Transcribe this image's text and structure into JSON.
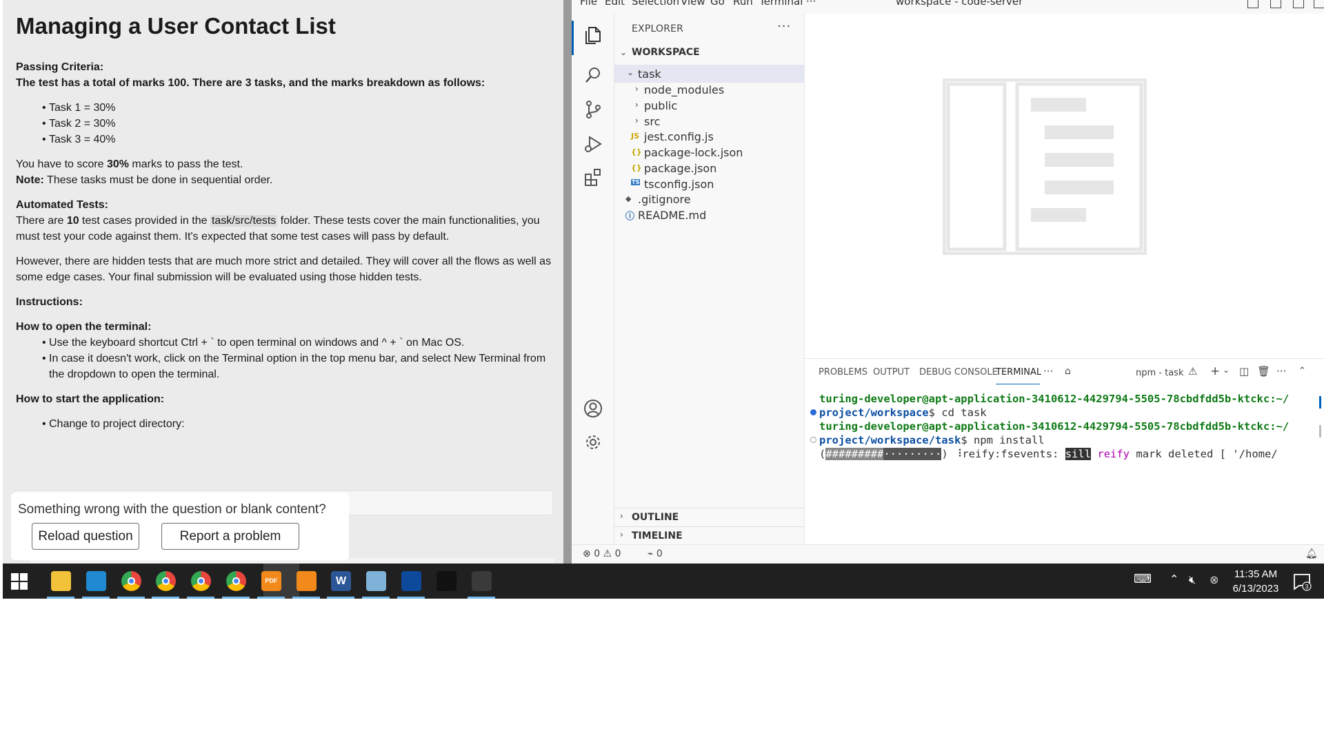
{
  "doc": {
    "title": "Managing a User Contact List",
    "passing_heading": "Passing Criteria:",
    "passing_desc": "The test has a total of marks 100. There are 3 tasks, and the marks breakdown as follows:",
    "tasks": [
      "Task 1 = 30%",
      "Task 2 = 30%",
      "Task 3 = 40%"
    ],
    "score_pre": "You have to score ",
    "score_value": "30%",
    "score_post": " marks to pass the test.",
    "note_label": "Note:",
    "note_text": " These tasks must be done in sequential order.",
    "auto_heading": "Automated Tests:",
    "auto_p1_a": "There are ",
    "auto_p1_count": "10",
    "auto_p1_b": " test cases provided in the ",
    "auto_p1_code": "task/src/tests",
    "auto_p1_c": " folder. These tests cover the main functionalities, you must test your code against them. It's expected that some test cases will pass by default.",
    "auto_p2": "However, there are hidden tests that are much more strict and detailed. They will cover all the flows as well as some edge cases. Your final submission will be evaluated using those hidden tests.",
    "instructions_heading": "Instructions:",
    "terminal_heading": "How to open the terminal:",
    "terminal_items": [
      "Use the keyboard shortcut Ctrl + ` to open terminal on windows and ^ + ` on Mac OS.",
      "In case it doesn't work, click on the Terminal option in the top menu bar, and select New Terminal from the dropdown to open the terminal."
    ],
    "start_heading": "How to start the application:",
    "start_items": [
      "Change to project directory:"
    ]
  },
  "feedback": {
    "prompt": "Something wrong with the question or blank content?",
    "reload_label": "Reload question",
    "report_label": "Report a problem"
  },
  "vscode": {
    "menu": [
      "File",
      "Edit",
      "Selection",
      "View",
      "Go",
      "Run",
      "Terminal",
      "···"
    ],
    "window_title": "workspace - code-server",
    "explorer_title": "EXPLORER",
    "explorer_more": "···",
    "workspace_label": "WORKSPACE",
    "tree": [
      {
        "name": "task",
        "kind": "folder-open"
      },
      {
        "name": "node_modules",
        "kind": "folder"
      },
      {
        "name": "public",
        "kind": "folder"
      },
      {
        "name": "src",
        "kind": "folder"
      },
      {
        "name": "jest.config.js",
        "kind": "js",
        "icon": "JS"
      },
      {
        "name": "package-lock.json",
        "kind": "json",
        "icon": "{}"
      },
      {
        "name": "package.json",
        "kind": "json",
        "icon": "{}"
      },
      {
        "name": "tsconfig.json",
        "kind": "ts",
        "icon": "TS"
      },
      {
        "name": ".gitignore",
        "kind": "git",
        "icon": "◆"
      },
      {
        "name": "README.md",
        "kind": "info",
        "icon": "ⓘ"
      }
    ],
    "outline_label": "OUTLINE",
    "timeline_label": "TIMELINE",
    "panel_tabs": [
      "PROBLEMS",
      "OUTPUT",
      "DEBUG CONSOLE",
      "TERMINAL"
    ],
    "panel_more": "···",
    "terminal_name": "npm - task",
    "terminal": {
      "user_host": "turing-developer@apt-application-3410612-4429794-5505-78cbdfdd5b-ktckc:~/",
      "path1": "project/workspace",
      "cmd1": "$ cd task",
      "path2": "project/workspace/task",
      "cmd2": "$ npm install",
      "progress_open": "(",
      "progress_done": "#########",
      "progress_rest": "·········",
      "progress_close": ") ",
      "spinner": "⠸",
      "step": "reify:fsevents: ",
      "level": "sill",
      "sp": " ",
      "reify": "reify",
      "rest": " mark deleted [ '/home/"
    },
    "status": {
      "errors": "0",
      "warnings": "0",
      "ports": "0"
    }
  },
  "taskbar": {
    "apps": [
      {
        "name": "file-explorer",
        "color": "#f3c23b"
      },
      {
        "name": "vscode",
        "color": "#1f8ad2"
      },
      {
        "name": "chrome",
        "color": "#e8453c"
      },
      {
        "name": "chrome",
        "color": "#e8453c"
      },
      {
        "name": "chrome",
        "color": "#e8453c"
      },
      {
        "name": "chrome-active",
        "color": "#e8453c"
      },
      {
        "name": "pdf",
        "color": "#f28a1b",
        "label": "PDF"
      },
      {
        "name": "search-tool",
        "color": "#f28a1b"
      },
      {
        "name": "word",
        "color": "#2b5797",
        "label": "W"
      },
      {
        "name": "notepad",
        "color": "#7fb2d8"
      },
      {
        "name": "teamviewer",
        "color": "#0e4a9c"
      },
      {
        "name": "terminal",
        "color": "#111111"
      },
      {
        "name": "calculator",
        "color": "#3a3a3a"
      }
    ],
    "time": "11:35 AM",
    "date": "6/13/2023",
    "notif_count": "3"
  }
}
